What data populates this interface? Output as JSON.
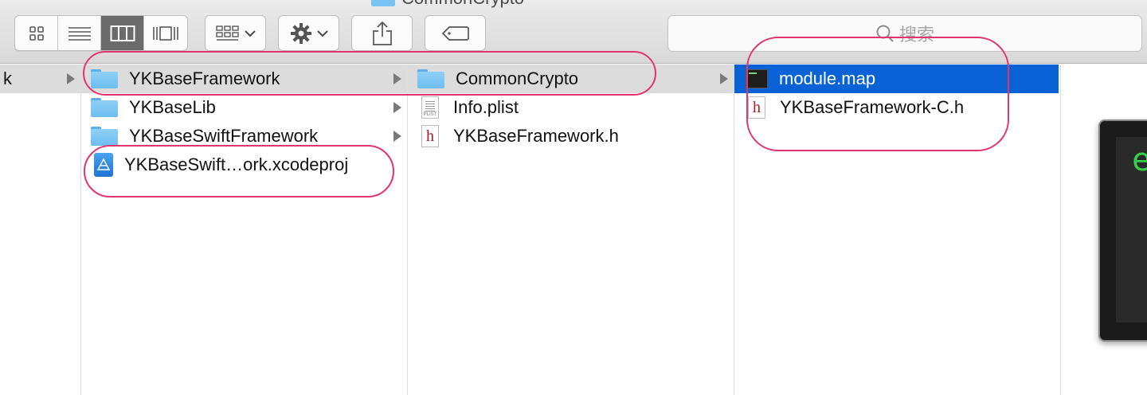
{
  "window": {
    "title": "CommonCrypto"
  },
  "toolbar": {
    "view_modes": [
      "icon-view",
      "list-view",
      "column-view",
      "cover-flow-view"
    ],
    "active_view": "column-view",
    "group_button_icon": "group-icon",
    "action_button_icon": "gear-icon",
    "share_button_icon": "share-icon",
    "tag_button_icon": "tag-icon"
  },
  "search": {
    "placeholder": "搜索",
    "icon": "search-icon"
  },
  "columns": [
    {
      "id": "col0",
      "items": [
        {
          "label": "k",
          "type": "folder",
          "expandable": true,
          "state": "highlighted"
        }
      ]
    },
    {
      "id": "col1",
      "items": [
        {
          "label": "YKBaseFramework",
          "type": "folder",
          "expandable": true,
          "state": "highlighted"
        },
        {
          "label": "YKBaseLib",
          "type": "folder",
          "expandable": true,
          "state": "normal"
        },
        {
          "label": "YKBaseSwiftFramework",
          "type": "folder",
          "expandable": true,
          "state": "normal"
        },
        {
          "label": "YKBaseSwift…ork.xcodeproj",
          "type": "xcodeproj",
          "expandable": false,
          "state": "normal"
        }
      ]
    },
    {
      "id": "col2",
      "items": [
        {
          "label": "CommonCrypto",
          "type": "folder",
          "expandable": true,
          "state": "highlighted"
        },
        {
          "label": "Info.plist",
          "type": "plist",
          "expandable": false,
          "state": "normal",
          "icon_caption": "PLIST"
        },
        {
          "label": "YKBaseFramework.h",
          "type": "header",
          "expandable": false,
          "state": "normal",
          "icon_glyph": "h"
        }
      ]
    },
    {
      "id": "col3",
      "items": [
        {
          "label": "module.map",
          "type": "terminal-file",
          "expandable": false,
          "state": "selected"
        },
        {
          "label": "YKBaseFramework-C.h",
          "type": "header",
          "expandable": false,
          "state": "normal",
          "icon_glyph": "h"
        }
      ]
    }
  ],
  "side_window": {
    "glyph": "e"
  },
  "colors": {
    "selection": "#0a63d6",
    "highlight": "#dcdcdc",
    "annotation": "#e3356d",
    "folder": "#78c3f2"
  }
}
